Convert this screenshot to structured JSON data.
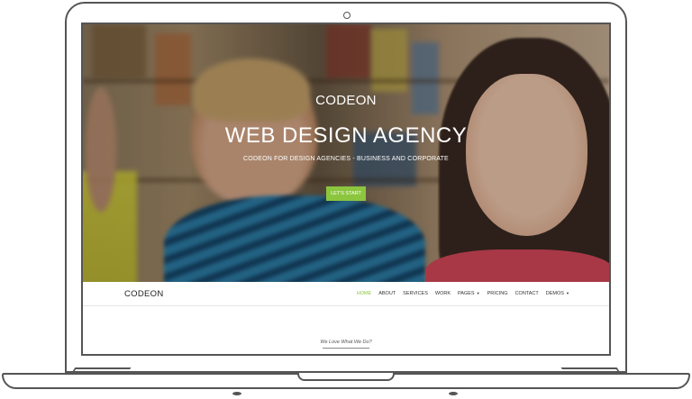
{
  "hero": {
    "kicker": "CODEON",
    "title": "WEB DESIGN AGENCY",
    "subtitle": "CODEON FOR DESIGN AGENCIES - BUSINESS AND CORPORATE",
    "cta_label": "LET'S START"
  },
  "navbar": {
    "brand": "CODEON",
    "items": [
      {
        "label": "HOME",
        "active": true
      },
      {
        "label": "ABOUT"
      },
      {
        "label": "SERVICES"
      },
      {
        "label": "WORK"
      },
      {
        "label": "PAGES",
        "dropdown": true
      },
      {
        "label": "PRICING"
      },
      {
        "label": "CONTACT"
      },
      {
        "label": "DEMOS",
        "dropdown": true
      }
    ]
  },
  "section": {
    "tagline": "We Love What We Do?"
  },
  "colors": {
    "accent": "#8cc63e",
    "frame": "#555555"
  }
}
